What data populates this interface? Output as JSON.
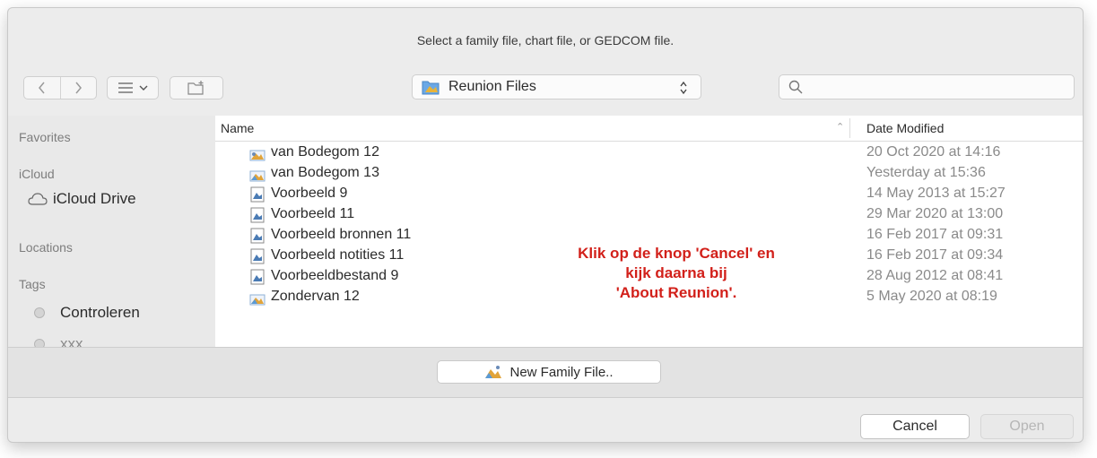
{
  "dialog": {
    "prompt": "Select a family file, chart file, or GEDCOM file."
  },
  "toolbar": {
    "back_icon": "chevron-left-icon",
    "forward_icon": "chevron-right-icon",
    "view_icon": "list-view-icon",
    "new_folder_icon": "new-folder-icon",
    "location": "Reunion Files",
    "search_placeholder": ""
  },
  "sidebar": {
    "favorites": "Favorites",
    "icloud": "iCloud",
    "icloud_drive": "iCloud Drive",
    "locations": "Locations",
    "tags": "Tags",
    "tag_items": [
      {
        "label": "Controleren"
      },
      {
        "label": "xxx"
      }
    ]
  },
  "filelist": {
    "col_name": "Name",
    "col_date": "Date Modified",
    "rows": [
      {
        "name": "van Bodegom 12",
        "date": "20 Oct 2020 at 14:16",
        "icon": "family-file-icon"
      },
      {
        "name": "van Bodegom 13",
        "date": "Yesterday at 15:36",
        "icon": "family-file-icon"
      },
      {
        "name": "Voorbeeld 9",
        "date": "14 May 2013 at 15:27",
        "icon": "chart-file-icon"
      },
      {
        "name": "Voorbeeld 11",
        "date": "29 Mar 2020 at 13:00",
        "icon": "chart-file-icon"
      },
      {
        "name": "Voorbeeld bronnen 11",
        "date": "16 Feb 2017 at 09:31",
        "icon": "chart-file-icon"
      },
      {
        "name": "Voorbeeld notities 11",
        "date": "16 Feb 2017 at 09:34",
        "icon": "chart-file-icon"
      },
      {
        "name": "Voorbeeldbestand 9",
        "date": "28 Aug 2012 at 08:41",
        "icon": "chart-file-icon"
      },
      {
        "name": "Zondervan 12",
        "date": "5 May 2020 at 08:19",
        "icon": "family-file-icon"
      }
    ]
  },
  "annotation": {
    "line1": "Klik op de knop 'Cancel' en",
    "line2": "kijk daarna bij",
    "line3": "'About Reunion'."
  },
  "accessory": {
    "new_family_label": "New Family File.."
  },
  "footer": {
    "cancel_label": "Cancel",
    "open_label": "Open"
  },
  "colors": {
    "annotation": "#d2201a",
    "dialog_bg": "#ececec"
  }
}
